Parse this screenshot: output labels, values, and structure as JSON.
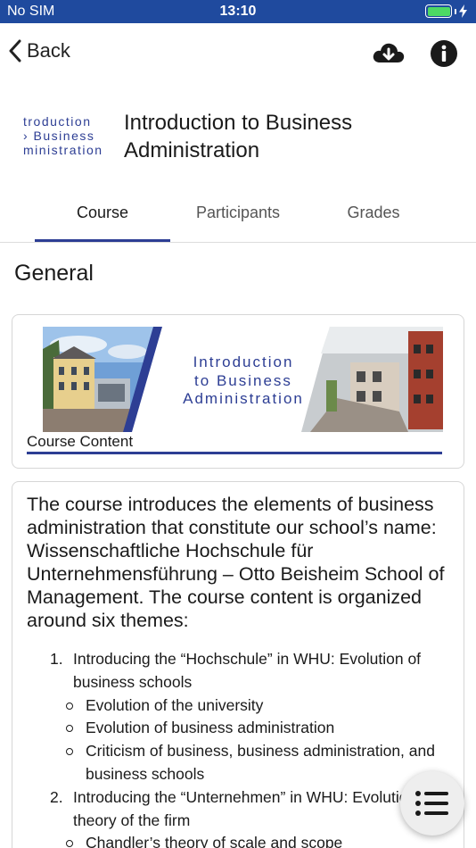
{
  "status_bar": {
    "carrier": "No SIM",
    "time": "13:10",
    "battery_level": 1.0
  },
  "nav": {
    "back_label": "Back",
    "download_icon": "cloud-download-icon",
    "info_icon": "info-icon"
  },
  "course": {
    "logo_lines": [
      "troduction",
      "› Business",
      "ministration"
    ],
    "title": "Introduction to Business Administration"
  },
  "tabs": [
    {
      "label": "Course",
      "active": true
    },
    {
      "label": "Participants",
      "active": false
    },
    {
      "label": "Grades",
      "active": false
    }
  ],
  "section": {
    "title": "General"
  },
  "banner": {
    "lines": [
      "Introduction",
      "to Business",
      "Administration"
    ],
    "label": "Course Content",
    "accent_color": "#2d3e94"
  },
  "description": {
    "intro": "The course introduces the elements of business administration that constitute our school’s name: Wissenschaftliche Hochschule für Unternehmensführung – Otto Beisheim School of Management. The course content is organized around six themes:",
    "themes": [
      {
        "number": "1.",
        "text": "Introducing the “Hochschule” in WHU: Evolution of business schools",
        "subitems": [
          "Evolution of the university",
          "Evolution of business administration",
          "Criticism of business, business administration, and business schools"
        ]
      },
      {
        "number": "2.",
        "text": "Introducing the “Unternehmen” in WHU: Evolution and theory of the firm",
        "subitems": [
          "Chandler’s theory of scale and scope"
        ]
      }
    ]
  },
  "fab": {
    "icon": "list-icon"
  }
}
